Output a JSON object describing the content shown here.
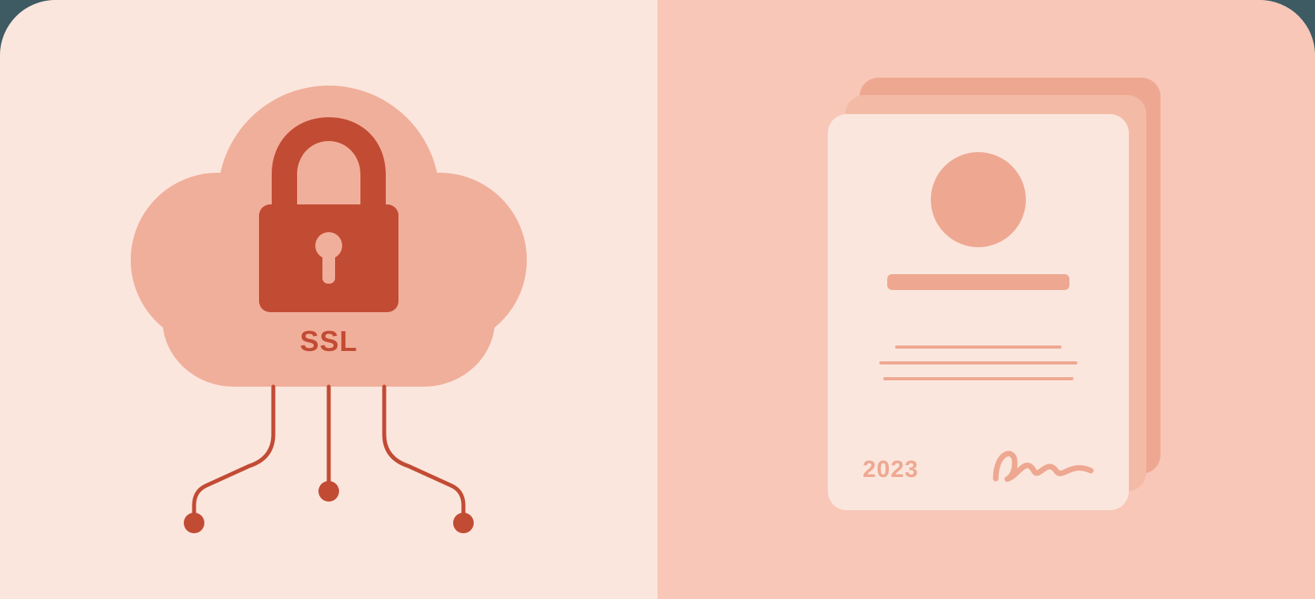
{
  "colors": {
    "bg_outer": "#3e5b64",
    "panel_light": "#fbe6de",
    "panel_mid": "#f8c7b7",
    "cloud": "#f0af9a",
    "accent_dark": "#c24b34",
    "cert_tone": "#eea891"
  },
  "left": {
    "protocol_label": "SSL",
    "icon": "lock-icon"
  },
  "right": {
    "certificate_year": "2023"
  }
}
